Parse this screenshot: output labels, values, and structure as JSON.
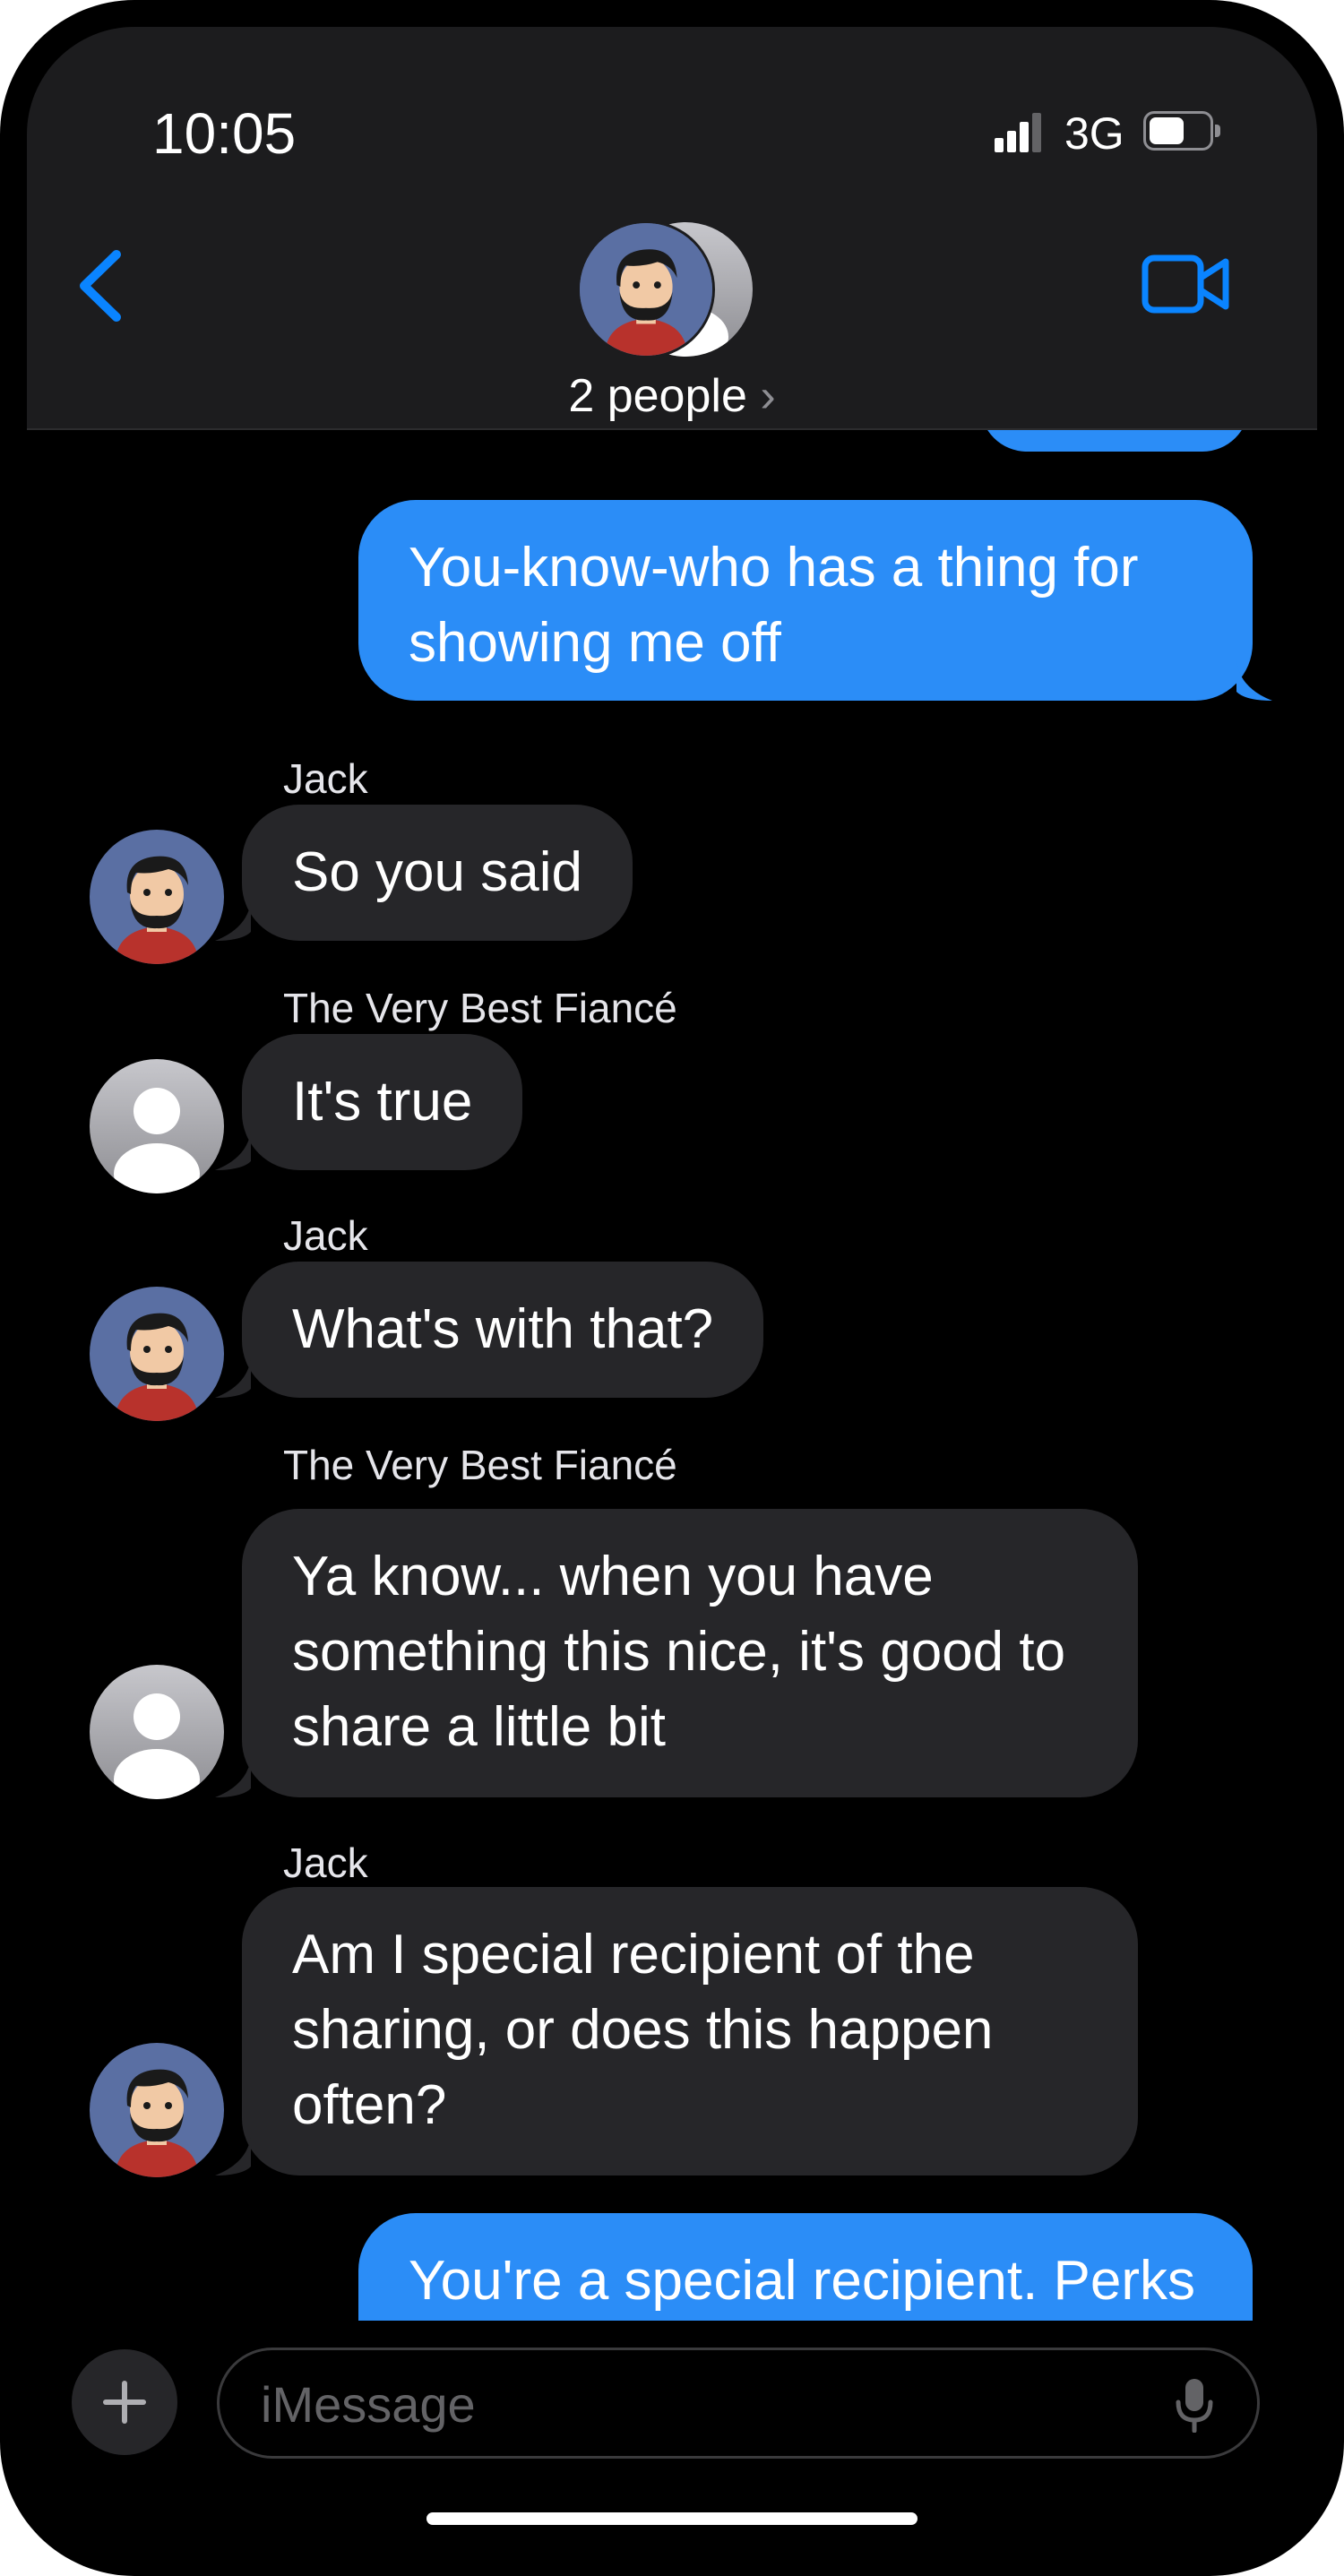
{
  "status_bar": {
    "time": "10:05",
    "network": "3G",
    "signal_bars": 3,
    "battery_fraction": 0.6
  },
  "header": {
    "title": "2 people",
    "chevron": "›",
    "back_icon": "chevron-left-icon",
    "video_icon": "video-camera-icon"
  },
  "colors": {
    "accent": "#0a84ff",
    "outgoing_bubble": "#2b8df7",
    "incoming_bubble": "#262629",
    "background": "#000000"
  },
  "messages": [
    {
      "direction": "outgoing",
      "text": "You-know-who has a thing for showing me off"
    },
    {
      "direction": "incoming",
      "sender": "Jack",
      "text": "So you said"
    },
    {
      "direction": "incoming",
      "sender": "The Very Best Fiancé",
      "text": "It's true"
    },
    {
      "direction": "incoming",
      "sender": "Jack",
      "text": "What's with that?"
    },
    {
      "direction": "incoming",
      "sender": "The Very Best Fiancé",
      "text": "Ya know... when you have something this nice, it's good to share a little bit"
    },
    {
      "direction": "incoming",
      "sender": "Jack",
      "text": "Am I special recipient of the sharing, or does this happen often?"
    },
    {
      "direction": "outgoing",
      "text": "You're a special recipient.  Perks"
    }
  ],
  "composer": {
    "placeholder": "iMessage",
    "plus_icon": "plus-icon",
    "mic_icon": "microphone-icon"
  }
}
